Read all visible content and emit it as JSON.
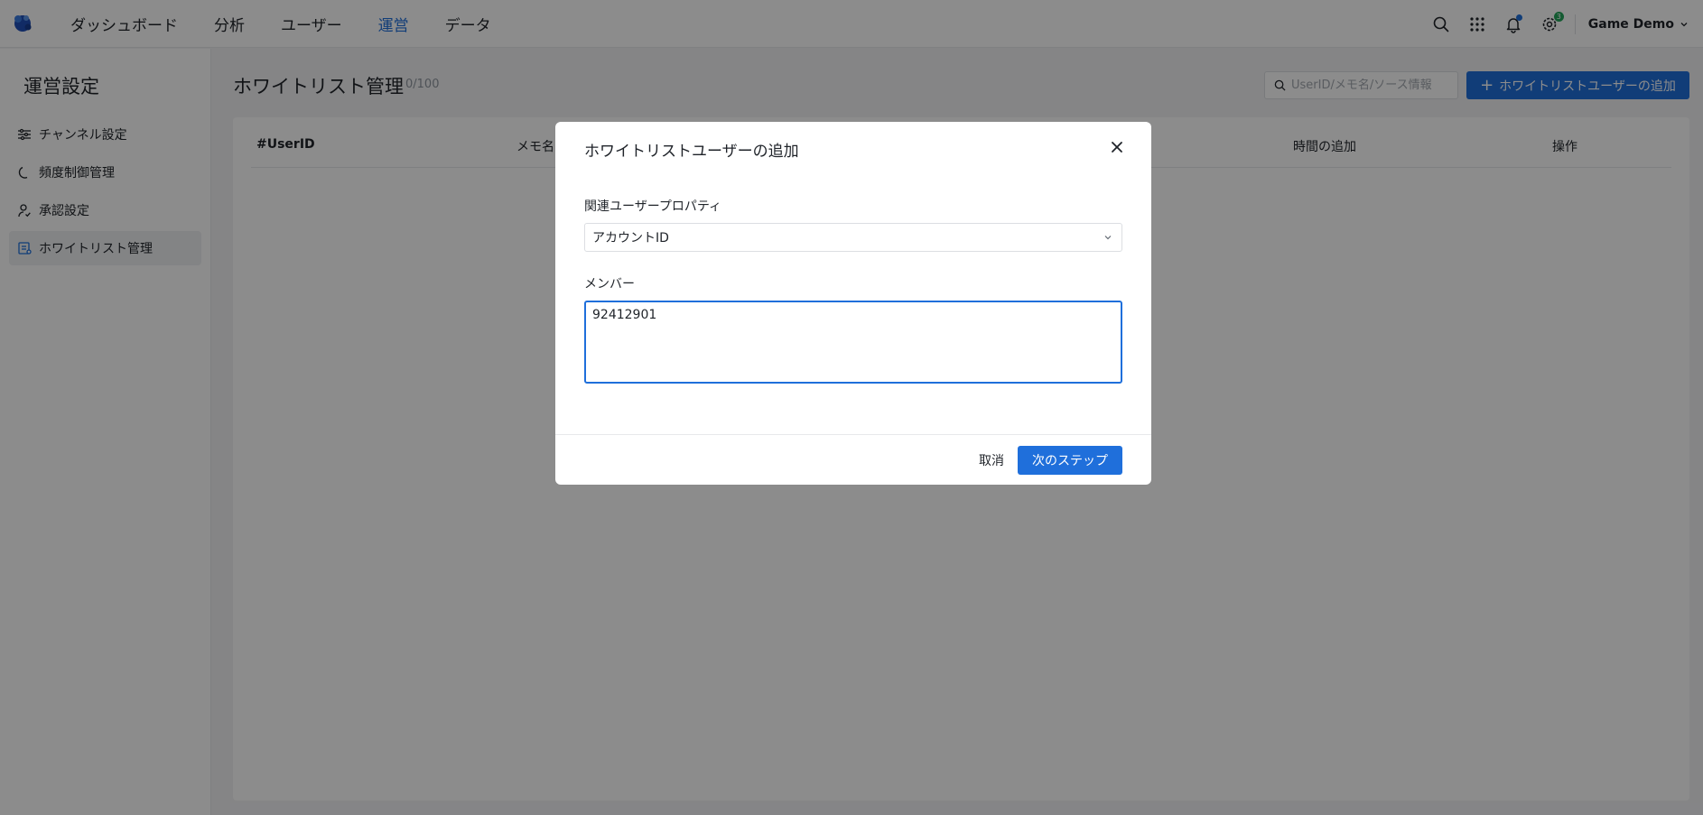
{
  "nav": {
    "items": [
      {
        "label": "ダッシュボード"
      },
      {
        "label": "分析"
      },
      {
        "label": "ユーザー"
      },
      {
        "label": "運営"
      },
      {
        "label": "データ"
      }
    ],
    "active_index": 3,
    "notification_badge": "3",
    "user_name": "Game Demo"
  },
  "sidebar": {
    "title": "運営設定",
    "items": [
      {
        "label": "チャンネル設定",
        "icon": "sliders-icon"
      },
      {
        "label": "頻度制御管理",
        "icon": "moon-icon"
      },
      {
        "label": "承認設定",
        "icon": "user-check-icon"
      },
      {
        "label": "ホワイトリスト管理",
        "icon": "whitelist-icon"
      }
    ],
    "active_index": 3
  },
  "main": {
    "title": "ホワイトリスト管理",
    "count": "0/100",
    "search_placeholder": "UserID/メモ名/ソース情報",
    "add_button_label": "ホワイトリストユーザーの追加",
    "table": {
      "columns": [
        "#UserID",
        "メモ名",
        "時間の追加",
        "操作"
      ]
    }
  },
  "modal": {
    "title": "ホワイトリストユーザーの追加",
    "property_label": "関連ユーザープロパティ",
    "property_value": "アカウントID",
    "member_label": "メンバー",
    "member_value": "92412901",
    "cancel_label": "取消",
    "next_label": "次のステップ"
  },
  "colors": {
    "accent": "#1f6fdb",
    "badge_green": "#23a55a"
  }
}
